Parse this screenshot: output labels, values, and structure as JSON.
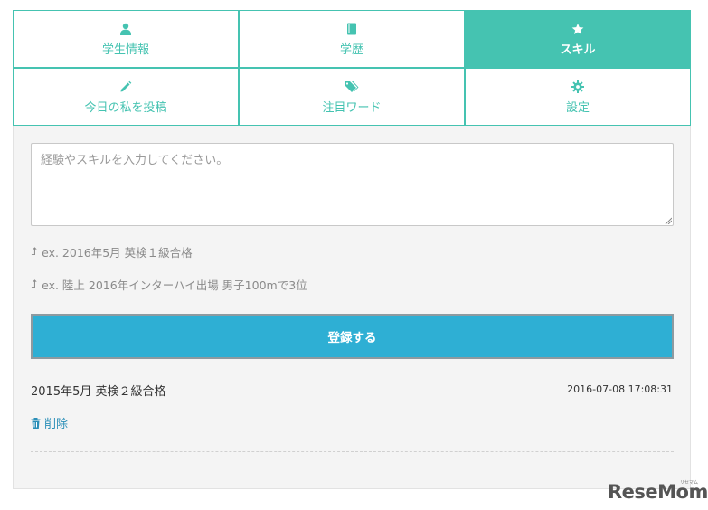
{
  "tabs": [
    {
      "label": "学生情報",
      "icon": "user-icon",
      "active": false
    },
    {
      "label": "学歴",
      "icon": "book-icon",
      "active": false
    },
    {
      "label": "スキル",
      "icon": "star-icon",
      "active": true
    },
    {
      "label": "今日の私を投稿",
      "icon": "pencil-icon",
      "active": false
    },
    {
      "label": "注目ワード",
      "icon": "tags-icon",
      "active": false
    },
    {
      "label": "設定",
      "icon": "gear-icon",
      "active": false
    }
  ],
  "form": {
    "placeholder": "経験やスキルを入力してください。",
    "example1": "ex. 2016年5月 英検１級合格",
    "example2": "ex. 陸上 2016年インターハイ出場 男子100mで3位",
    "submit_label": "登録する"
  },
  "entries": [
    {
      "text": "2015年5月 英検２級合格",
      "date": "2016-07-08 17:08:31",
      "delete_label": "削除"
    }
  ],
  "watermark": {
    "text": "ReseMom",
    "small": "リセマム"
  }
}
